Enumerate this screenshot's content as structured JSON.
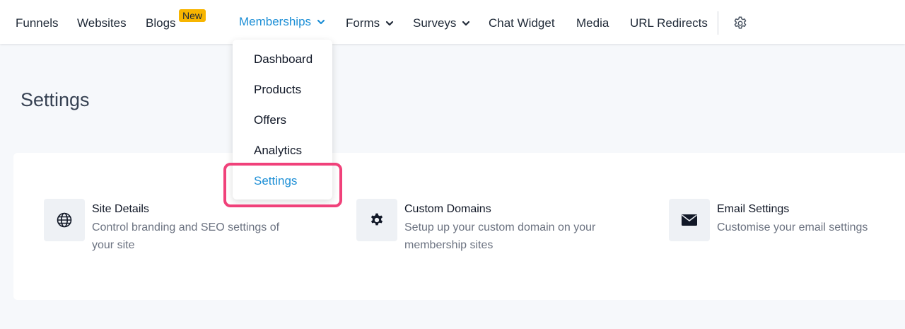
{
  "nav": {
    "items": [
      {
        "label": "Funnels"
      },
      {
        "label": "Websites"
      },
      {
        "label": "Blogs",
        "badge": "New"
      },
      {
        "label": "Memberships",
        "active": true
      },
      {
        "label": "Forms"
      },
      {
        "label": "Surveys"
      },
      {
        "label": "Chat Widget"
      },
      {
        "label": "Media"
      },
      {
        "label": "URL Redirects"
      }
    ],
    "settings_icon": "gear-icon",
    "accent_color": "#1d8fd6"
  },
  "dropdown": {
    "items": [
      {
        "label": "Dashboard"
      },
      {
        "label": "Products"
      },
      {
        "label": "Offers"
      },
      {
        "label": "Analytics"
      },
      {
        "label": "Settings",
        "active": true
      }
    ],
    "highlight_color": "#f0417a"
  },
  "page": {
    "title": "Settings"
  },
  "settings": [
    {
      "title": "Site Details",
      "description": "Control branding and SEO settings of your site",
      "icon": "globe-icon"
    },
    {
      "title": "Custom Domains",
      "description": "Setup up your custom domain on your membership sites",
      "icon": "cog-icon"
    },
    {
      "title": "Email Settings",
      "description": "Customise your email settings",
      "icon": "envelope-icon"
    }
  ],
  "badge_color": "#f7b500"
}
